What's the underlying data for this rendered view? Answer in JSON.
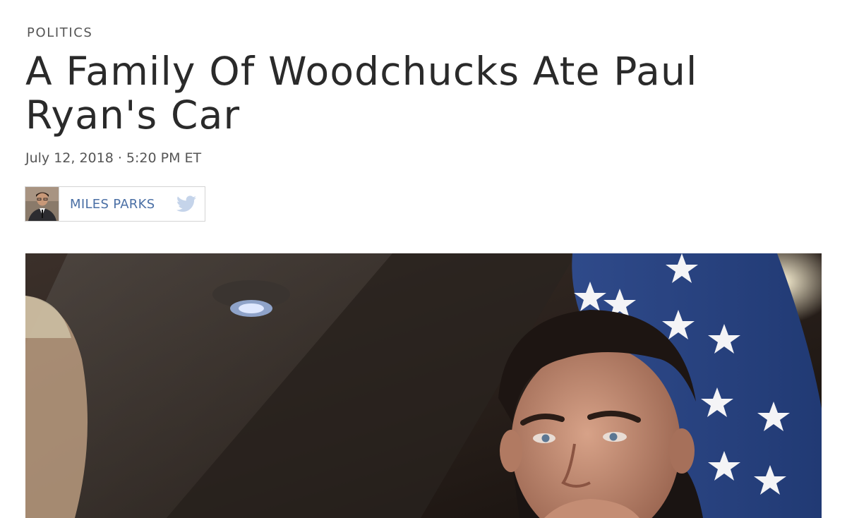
{
  "article": {
    "section": "POLITICS",
    "headline": "A Family Of Woodchucks Ate Paul Ryan's Car",
    "dateline": "July 12, 2018 · 5:20 PM ET",
    "author": {
      "name": "MILES PARKS",
      "social_icon": "twitter-bird-icon"
    },
    "photo": {
      "subject": "lead-photo"
    }
  },
  "colors": {
    "author_link": "#4a6fa5",
    "twitter_icon": "#c5d4ea",
    "text": "#2a2a2a",
    "muted": "#555555"
  }
}
